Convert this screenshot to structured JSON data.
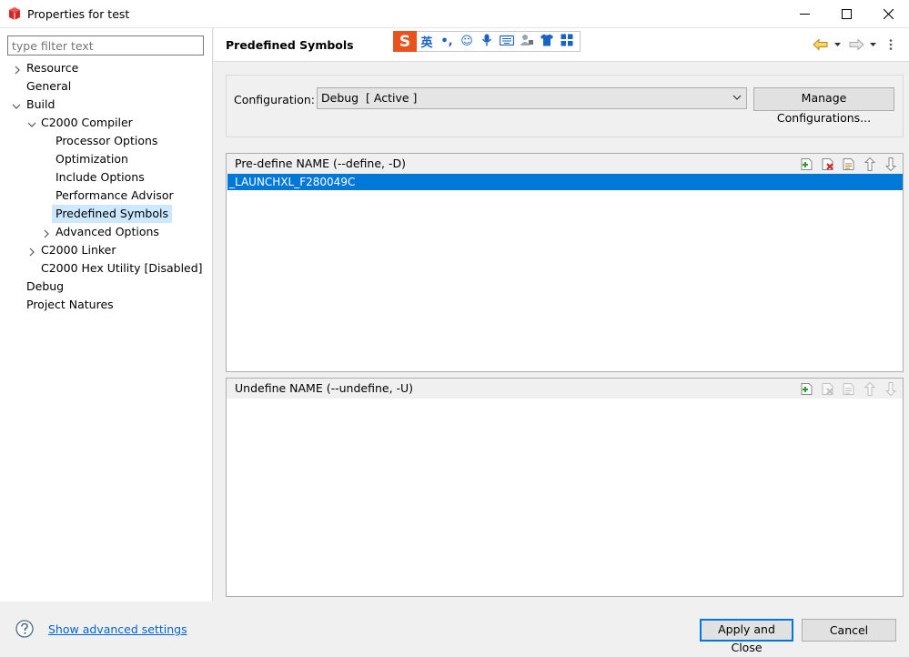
{
  "window": {
    "title": "Properties for test",
    "icon": "project-properties-icon",
    "controls": [
      "minimize-icon",
      "maximize-icon",
      "close-icon"
    ]
  },
  "filter": {
    "placeholder": "type filter text",
    "value": ""
  },
  "tree": {
    "items": [
      {
        "label": "Resource",
        "expander": "collapsed"
      },
      {
        "label": "General"
      },
      {
        "label": "Build",
        "expander": "expanded"
      },
      {
        "label": "C2000 Compiler",
        "expander": "expanded"
      },
      {
        "label": "Processor Options"
      },
      {
        "label": "Optimization"
      },
      {
        "label": "Include Options"
      },
      {
        "label": "Performance Advisor"
      },
      {
        "label": "Predefined Symbols",
        "selected": true
      },
      {
        "label": "Advanced Options",
        "expander": "collapsed"
      },
      {
        "label": "C2000 Linker",
        "expander": "collapsed"
      },
      {
        "label": "C2000 Hex Utility  [Disabled]"
      },
      {
        "label": "Debug"
      },
      {
        "label": "Project Natures"
      }
    ]
  },
  "page": {
    "title": "Predefined Symbols",
    "nav": [
      "back-arrow-icon",
      "back-menu-icon",
      "forward-arrow-icon",
      "forward-menu-icon",
      "view-menu-icon"
    ]
  },
  "ime": {
    "logo": "S",
    "glyphs": [
      "英",
      "•,",
      "☺",
      "mic-icon",
      "keyboard-icon",
      "user-icon",
      "shirt-icon",
      "grid-icon"
    ]
  },
  "configuration": {
    "label": "Configuration:",
    "selected": "Debug  [ Active ]",
    "manage_button": "Manage Configurations..."
  },
  "predefine": {
    "header": "Pre-define NAME (--define, -D)",
    "items": [
      "_LAUNCHXL_F280049C"
    ],
    "tools": [
      "add-icon",
      "delete-icon",
      "edit-icon",
      "move-up-icon",
      "move-down-icon"
    ]
  },
  "undefine": {
    "header": "Undefine NAME (--undefine, -U)",
    "items": [],
    "tools": [
      "add-icon",
      "delete-icon",
      "edit-icon",
      "move-up-icon",
      "move-down-icon"
    ]
  },
  "footer": {
    "advanced_link": "Show advanced settings",
    "apply_close": "Apply and Close",
    "cancel": "Cancel"
  },
  "colors": {
    "selection": "#0078d7",
    "tree_selection": "#cce8ff",
    "link": "#0066cc"
  }
}
